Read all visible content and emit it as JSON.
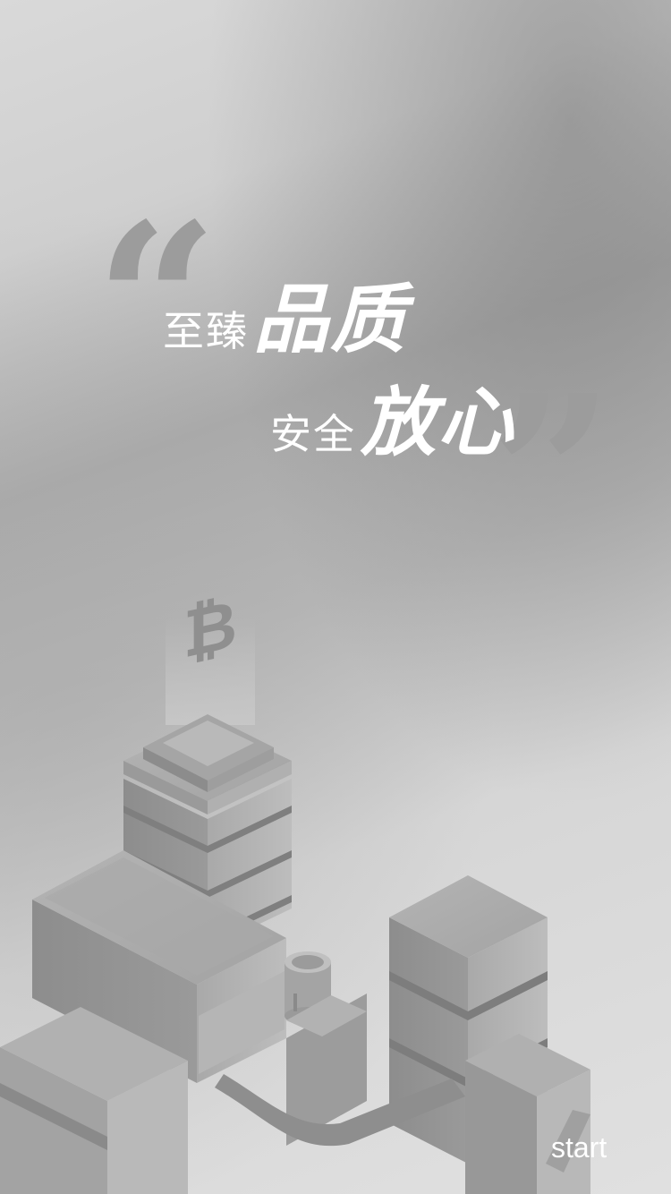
{
  "slogan": {
    "line1_small": "至臻",
    "line1_big": "品质",
    "line2_small": "安全",
    "line2_big": "放心"
  },
  "quotes": {
    "open": "“",
    "close": "”"
  },
  "start_label": "start",
  "illustration": {
    "icon": "bitcoin-icon",
    "accent_color": "#9c9c9c",
    "text_color": "#ffffff"
  }
}
